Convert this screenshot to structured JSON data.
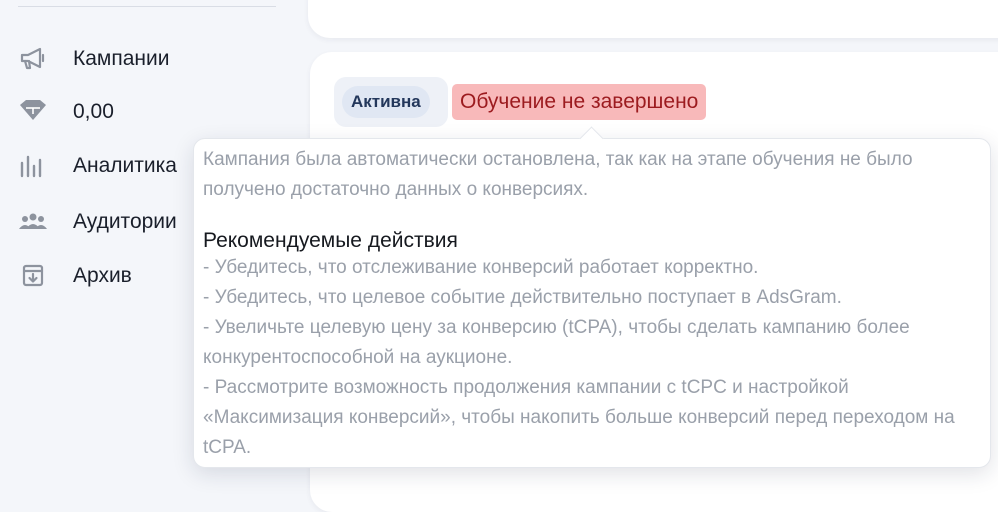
{
  "sidebar": {
    "items": [
      {
        "label": "Кампании",
        "icon": "megaphone-icon"
      },
      {
        "label": "0,00",
        "icon": "diamond-icon"
      },
      {
        "label": "Аналитика",
        "icon": "analytics-bars-icon"
      },
      {
        "label": "Аудитории",
        "icon": "audience-group-icon"
      },
      {
        "label": "Архив",
        "icon": "archive-box-icon"
      }
    ]
  },
  "campaign": {
    "status_badge": "Активна",
    "learning_badge": "Обучение не завершено"
  },
  "tooltip": {
    "description": "Кампания была автоматически остановлена, так как на этапе обучения не было получено достаточно данных о конверсиях.",
    "heading": "Рекомендуемые действия",
    "actions": [
      "- Убедитесь, что отслеживание конверсий работает корректно.",
      "- Убедитесь, что целевое событие действительно поступает в AdsGram.",
      "- Увеличьте целевую цену за конверсию (tCPA), чтобы сделать кампанию более конкурентоспособной на аукционе.",
      "- Рассмотрите возможность продолжения кампании с tCPC и настройкой «Максимизация конверсий», чтобы накопить больше конверсий перед переходом на tCPA."
    ]
  },
  "colors": {
    "background": "#f4f6fa",
    "card": "#ffffff",
    "active_badge_bg": "#e0e7f3",
    "active_badge_text": "#23375b",
    "learning_badge_bg": "#f8b9ba",
    "learning_badge_text": "#9c1b1f",
    "icon_gray": "#8d939e"
  }
}
